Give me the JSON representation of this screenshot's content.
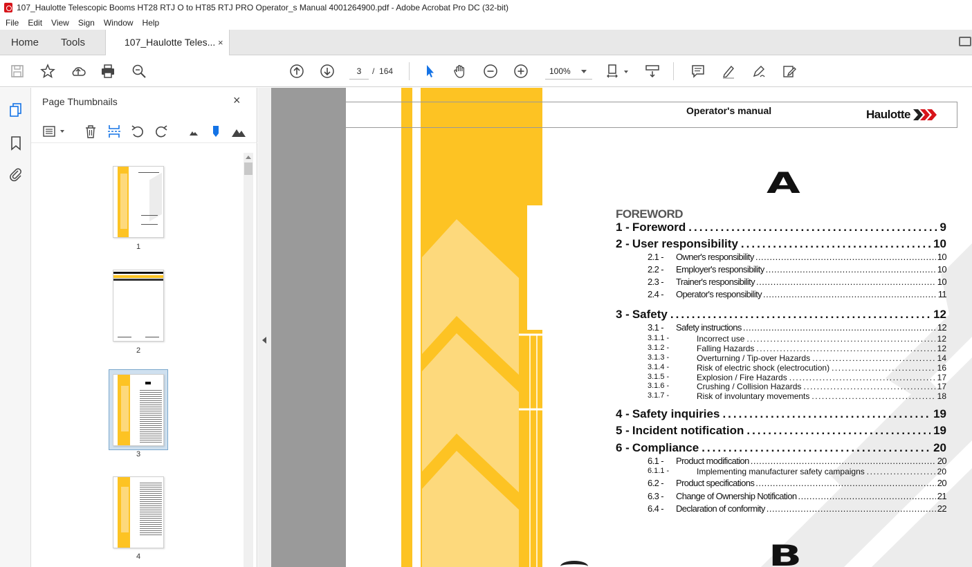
{
  "window": {
    "title": "107_Haulotte Telescopic Booms HT28 RTJ O to HT85 RTJ PRO Operator_s Manual 4001264900.pdf - Adobe Acrobat Pro DC (32-bit)"
  },
  "menu": [
    "File",
    "Edit",
    "View",
    "Sign",
    "Window",
    "Help"
  ],
  "tabs": {
    "home": "Home",
    "tools": "Tools",
    "document": "107_Haulotte Teles...",
    "close": "×"
  },
  "toolbar": {
    "current_page": "3",
    "page_separator": "/",
    "total_pages": "164",
    "zoom": "100%"
  },
  "panel": {
    "title": "Page Thumbnails",
    "close": "×",
    "thumbnails": [
      {
        "label": "1"
      },
      {
        "label": "2"
      },
      {
        "label": "3",
        "selected": true
      },
      {
        "label": "4"
      }
    ]
  },
  "document": {
    "header_title": "Operator's manual",
    "logo_text": "Haulotte",
    "section_letter_a": "A",
    "section_letter_b": "B",
    "section_heading": "FOREWORD",
    "toc": [
      {
        "level": 1,
        "num": "1 -",
        "text": "Foreword",
        "page": "9"
      },
      {
        "level": 1,
        "num": "2 -",
        "text": "User responsibility",
        "page": "10"
      },
      {
        "level": 2,
        "num": "2.1 -",
        "text": "Owner's responsibility",
        "page": "10"
      },
      {
        "level": 2,
        "num": "2.2 -",
        "text": "Employer's responsibility",
        "page": "10"
      },
      {
        "level": 2,
        "num": "2.3 -",
        "text": "Trainer's responsibility",
        "page": "10"
      },
      {
        "level": 2,
        "num": "2.4 -",
        "text": "Operator's responsibility",
        "page": "11"
      },
      {
        "level": 1,
        "num": "3 -",
        "text": "Safety",
        "page": "12"
      },
      {
        "level": 2,
        "num": "3.1 -",
        "text": "Safety instructions",
        "page": "12"
      },
      {
        "level": 3,
        "num": "3.1.1 -",
        "text": "Incorrect use",
        "page": "12"
      },
      {
        "level": 3,
        "num": "3.1.2 -",
        "text": "Falling Hazards",
        "page": "12"
      },
      {
        "level": 3,
        "num": "3.1.3 -",
        "text": "Overturning / Tip-over Hazards",
        "page": "14"
      },
      {
        "level": 3,
        "num": "3.1.4 -",
        "text": "Risk of electric shock (electrocution)",
        "page": "16"
      },
      {
        "level": 3,
        "num": "3.1.5 -",
        "text": "Explosion / Fire Hazards",
        "page": "17"
      },
      {
        "level": 3,
        "num": "3.1.6 -",
        "text": "Crushing / Collision Hazards",
        "page": "17"
      },
      {
        "level": 3,
        "num": "3.1.7 -",
        "text": "Risk of involuntary movements",
        "page": "18"
      },
      {
        "level": 1,
        "num": "4 -",
        "text": "Safety inquiries",
        "page": "19"
      },
      {
        "level": 1,
        "num": "5 -",
        "text": "Incident notification",
        "page": "19"
      },
      {
        "level": 1,
        "num": "6 -",
        "text": "Compliance",
        "page": "20"
      },
      {
        "level": 2,
        "num": "6.1 -",
        "text": "Product modification",
        "page": "20"
      },
      {
        "level": 3,
        "num": "6.1.1 -",
        "text": "Implementing manufacturer safety campaigns",
        "page": "20"
      },
      {
        "level": 2,
        "num": "6.2 -",
        "text": "Product specifications",
        "page": "20"
      },
      {
        "level": 2,
        "num": "6.3 -",
        "text": "Change of Ownership Notification",
        "page": "21"
      },
      {
        "level": 2,
        "num": "6.4 -",
        "text": "Declaration of conformity",
        "page": "22"
      }
    ]
  },
  "colors": {
    "accent_yellow": "#fdc323",
    "light_yellow": "#fdd97c",
    "watermark_gray": "#ececec",
    "logo_red": "#d7141a"
  }
}
